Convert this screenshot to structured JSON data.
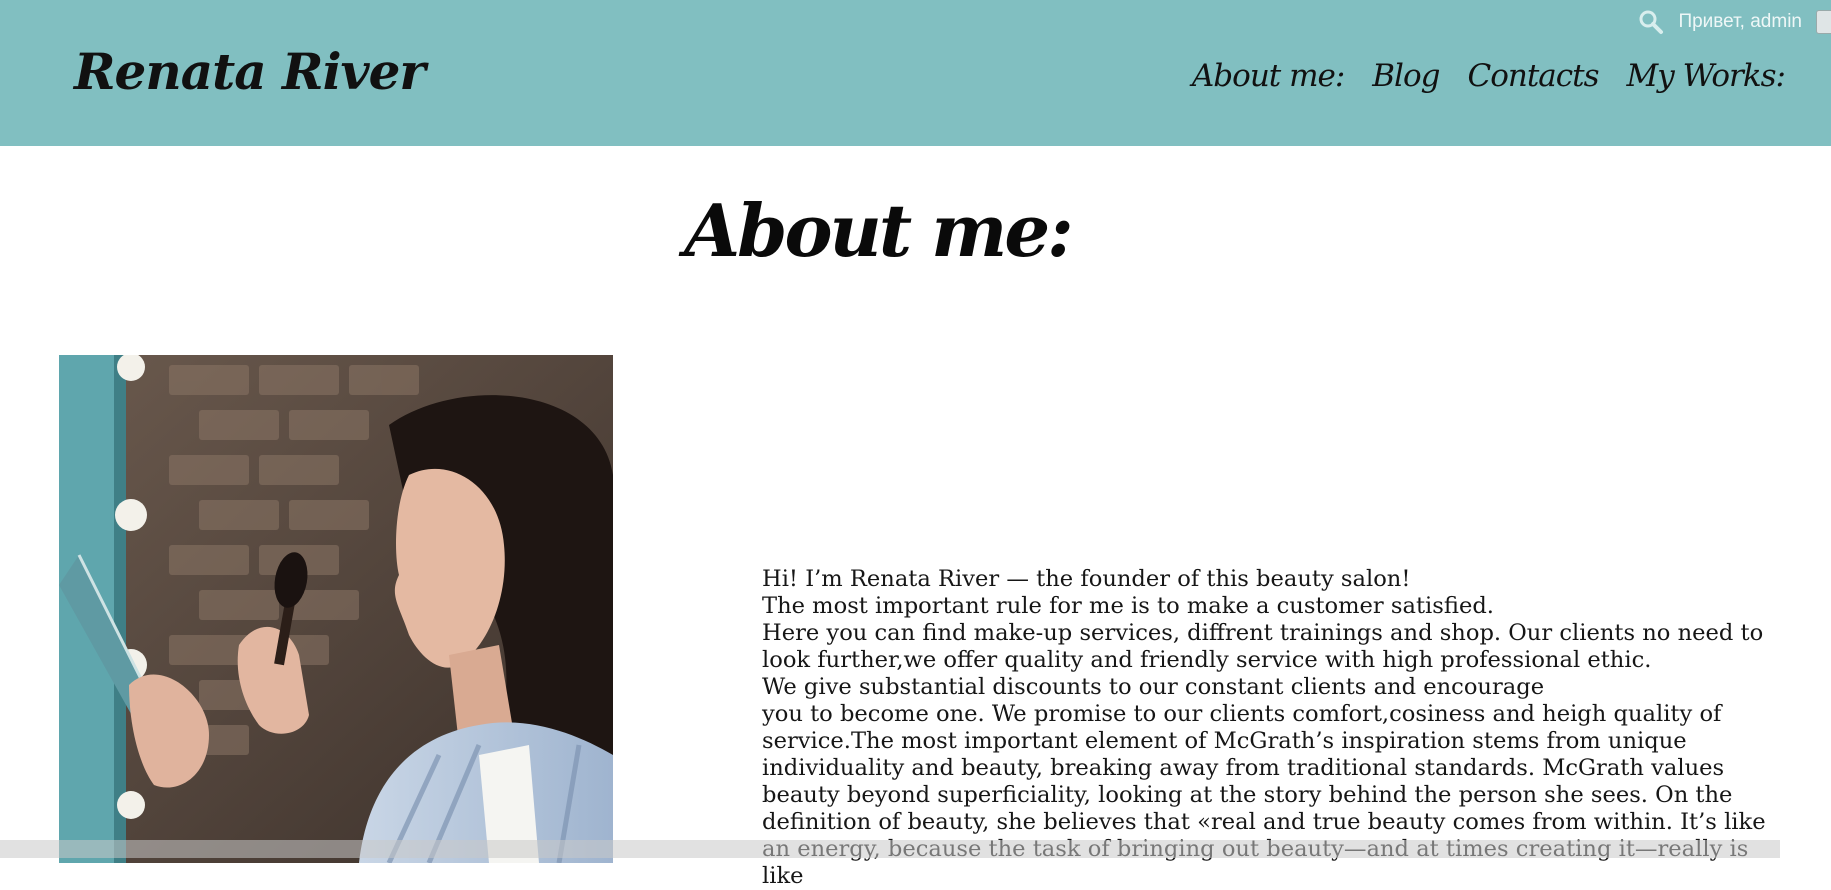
{
  "header": {
    "brand": "Renata River",
    "greeting": "Привет, admin",
    "nav": [
      "About me:",
      "Blog",
      "Contacts",
      "My Works:"
    ]
  },
  "page": {
    "title": "About me:"
  },
  "bio": {
    "paragraphs": [
      "Hi! I’m Renata River — the founder of this beauty salon!",
      "The most important rule for me is to make a customer satisfied.",
      "Here you can find make-up services, diffrent trainings and shop. Our clients no need to look further,we offer quality and friendly service with high professional ethic.",
      "We give substantial discounts to our constant clients and encourage\nyou to become one. We promise to our clients comfort,cosiness and heigh quality of service.The most important element of McGrath’s inspiration stems from unique individuality and beauty, breaking away from traditional standards. McGrath values beauty beyond superficiality, looking at the story behind the person she sees. On the definition of beauty, she believes that «real and true beauty comes from within. It’s like an energy, because the task of bringing out beauty—and at times creating it—really is like"
    ]
  },
  "icons": {
    "search": "search-icon",
    "photo": "makeup-artist-photo"
  },
  "colors": {
    "header_bg": "#81bfc1",
    "greeting_text": "#eef7f7",
    "text": "#161616"
  }
}
